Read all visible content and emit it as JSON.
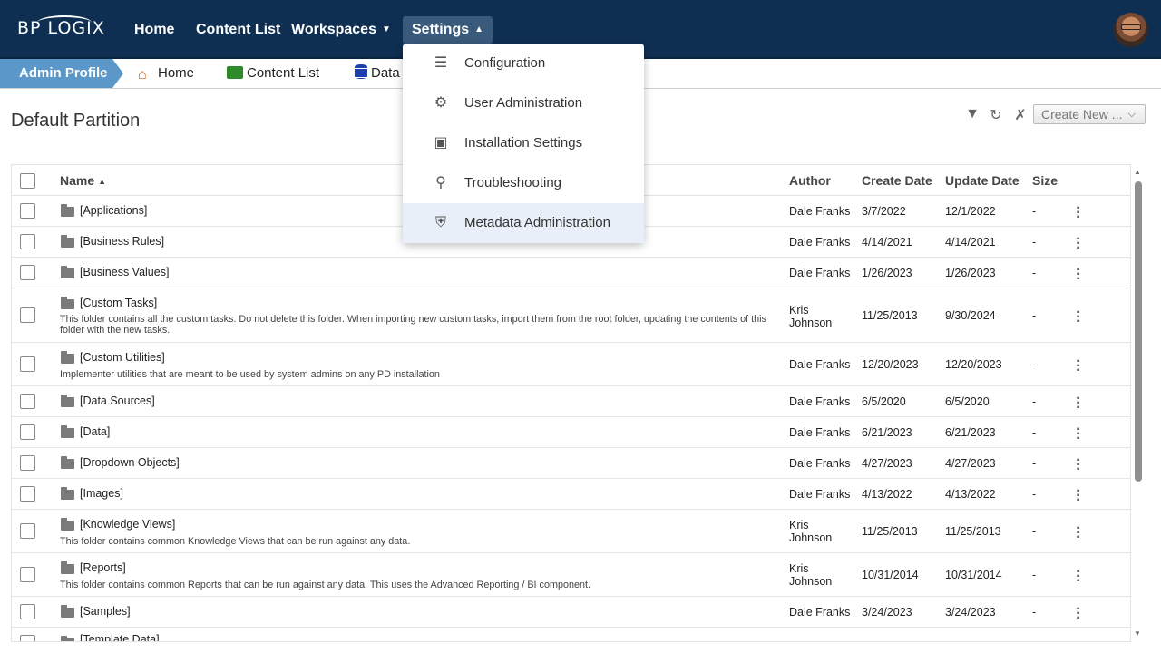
{
  "brand": {
    "logo_text": "BP LOGIX"
  },
  "topnav": {
    "items": [
      {
        "label": "Home"
      },
      {
        "label": "Content List"
      },
      {
        "label": "Workspaces"
      },
      {
        "label": "Settings"
      }
    ]
  },
  "breadcrumb": {
    "active": "Admin Profile",
    "items": [
      {
        "label": "Home",
        "icon": "home-icon"
      },
      {
        "label": "Content List",
        "icon": "folder-icon"
      },
      {
        "label": "Data",
        "icon": "database-icon"
      }
    ]
  },
  "settings_menu": {
    "items": [
      {
        "label": "Configuration",
        "icon": "sliders-icon"
      },
      {
        "label": "User Administration",
        "icon": "user-gear-icon"
      },
      {
        "label": "Installation Settings",
        "icon": "monitor-download-icon"
      },
      {
        "label": "Troubleshooting",
        "icon": "search-gear-icon"
      },
      {
        "label": "Metadata Administration",
        "icon": "shield-gear-icon"
      }
    ]
  },
  "page": {
    "title": "Default Partition",
    "create_new": "Create New ...",
    "tools": [
      "filter-icon",
      "refresh-icon",
      "tools-icon"
    ]
  },
  "table": {
    "columns": [
      "Name",
      "Author",
      "Create Date",
      "Update Date",
      "Size"
    ],
    "rows": [
      {
        "name": "[Applications]",
        "desc": "",
        "author": "Dale Franks",
        "created": "3/7/2022",
        "updated": "12/1/2022",
        "size": "-"
      },
      {
        "name": "[Business Rules]",
        "desc": "",
        "author": "Dale Franks",
        "created": "4/14/2021",
        "updated": "4/14/2021",
        "size": "-"
      },
      {
        "name": "[Business Values]",
        "desc": "",
        "author": "Dale Franks",
        "created": "1/26/2023",
        "updated": "1/26/2023",
        "size": "-"
      },
      {
        "name": "[Custom Tasks]",
        "desc": "This folder contains all the custom tasks. Do not delete this folder. When importing new custom tasks, import them from the root folder, updating the contents of this folder with the new tasks.",
        "author": "Kris Johnson",
        "created": "11/25/2013",
        "updated": "9/30/2024",
        "size": "-"
      },
      {
        "name": "[Custom Utilities]",
        "desc": "Implementer utilities that are meant to be used by system admins on any PD installation",
        "author": "Dale Franks",
        "created": "12/20/2023",
        "updated": "12/20/2023",
        "size": "-"
      },
      {
        "name": "[Data Sources]",
        "desc": "",
        "author": "Dale Franks",
        "created": "6/5/2020",
        "updated": "6/5/2020",
        "size": "-"
      },
      {
        "name": "[Data]",
        "desc": "",
        "author": "Dale Franks",
        "created": "6/21/2023",
        "updated": "6/21/2023",
        "size": "-"
      },
      {
        "name": "[Dropdown Objects]",
        "desc": "",
        "author": "Dale Franks",
        "created": "4/27/2023",
        "updated": "4/27/2023",
        "size": "-"
      },
      {
        "name": "[Images]",
        "desc": "",
        "author": "Dale Franks",
        "created": "4/13/2022",
        "updated": "4/13/2022",
        "size": "-"
      },
      {
        "name": "[Knowledge Views]",
        "desc": "This folder contains common Knowledge Views that can be run against any data.",
        "author": "Kris Johnson",
        "created": "11/25/2013",
        "updated": "11/25/2013",
        "size": "-"
      },
      {
        "name": "[Reports]",
        "desc": "This folder contains common Reports that can be run against any data. This uses the Advanced Reporting / BI component.",
        "author": "Kris Johnson",
        "created": "10/31/2014",
        "updated": "10/31/2014",
        "size": "-"
      },
      {
        "name": "[Samples]",
        "desc": "",
        "author": "Dale Franks",
        "created": "3/24/2023",
        "updated": "3/24/2023",
        "size": "-"
      },
      {
        "name": "[Template Data]",
        "desc": "",
        "author": "",
        "created": "",
        "updated": "",
        "size": ""
      }
    ]
  }
}
